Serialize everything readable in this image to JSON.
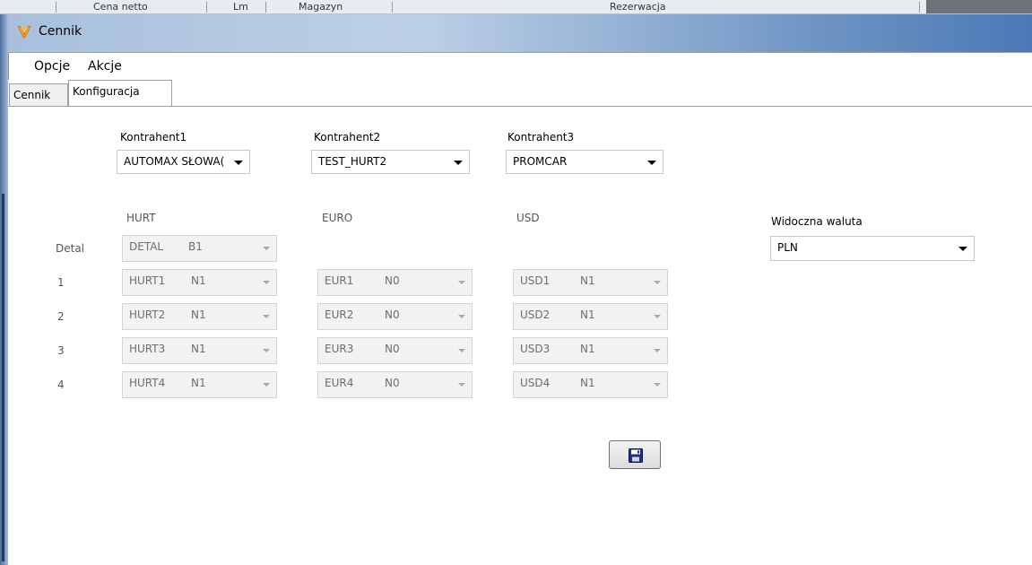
{
  "background_window": {
    "columns": [
      "Cena netto",
      "Lm",
      "Magazyn",
      "Rezerwacja"
    ]
  },
  "window": {
    "title": "Cennik",
    "icon": "app-logo-icon"
  },
  "menu": {
    "items": [
      "Opcje",
      "Akcje"
    ]
  },
  "tabs": [
    {
      "label": "Cennik",
      "active": false
    },
    {
      "label": "Konfiguracja",
      "active": true
    }
  ],
  "contractors": [
    {
      "label": "Kontrahent1",
      "value": "AUTOMAX SŁOWA("
    },
    {
      "label": "Kontrahent2",
      "value": "TEST_HURT2"
    },
    {
      "label": "Kontrahent3",
      "value": "PROMCAR"
    }
  ],
  "grid": {
    "headers": [
      "HURT",
      "EURO",
      "USD"
    ],
    "detal_label": "Detal",
    "detal": {
      "code": "DETAL",
      "sub": "B1"
    },
    "rows": [
      {
        "label": "1",
        "hurt": {
          "code": "HURT1",
          "sub": "N1"
        },
        "euro": {
          "code": "EUR1",
          "sub": "N0"
        },
        "usd": {
          "code": "USD1",
          "sub": "N1"
        }
      },
      {
        "label": "2",
        "hurt": {
          "code": "HURT2",
          "sub": "N1"
        },
        "euro": {
          "code": "EUR2",
          "sub": "N0"
        },
        "usd": {
          "code": "USD2",
          "sub": "N1"
        }
      },
      {
        "label": "3",
        "hurt": {
          "code": "HURT3",
          "sub": "N1"
        },
        "euro": {
          "code": "EUR3",
          "sub": "N0"
        },
        "usd": {
          "code": "USD3",
          "sub": "N1"
        }
      },
      {
        "label": "4",
        "hurt": {
          "code": "HURT4",
          "sub": "N1"
        },
        "euro": {
          "code": "EUR4",
          "sub": "N0"
        },
        "usd": {
          "code": "USD4",
          "sub": "N1"
        }
      }
    ]
  },
  "visible_currency": {
    "label": "Widoczna waluta",
    "value": "PLN"
  },
  "save_button": {
    "icon": "floppy-disk-icon"
  }
}
